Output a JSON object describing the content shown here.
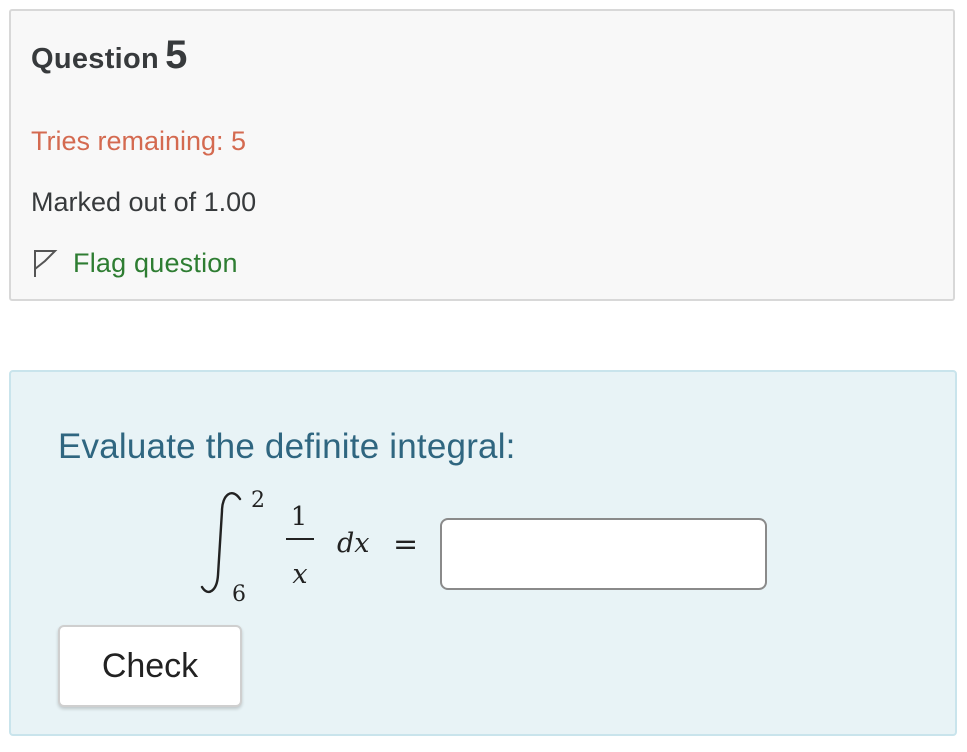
{
  "question": {
    "title_label": "Question",
    "number": "5",
    "tries_remaining": "Tries remaining: 5",
    "marked_out_of": "Marked out of 1.00",
    "flag_label": "Flag question",
    "flag_icon": "flag-outline-icon"
  },
  "colors": {
    "info_background": "#f8f8f8",
    "content_background": "#e8f3f6",
    "tries_text": "#d46a50",
    "flag_text": "#2e7d32",
    "prompt_text": "#2f6680"
  },
  "content": {
    "prompt": "Evaluate the definite integral:",
    "integral": {
      "upper_limit": "2",
      "lower_limit": "6",
      "numerator": "1",
      "denominator": "x",
      "differential": "dx",
      "equals": "="
    },
    "answer_value": "",
    "answer_placeholder": "",
    "check_label": "Check"
  }
}
